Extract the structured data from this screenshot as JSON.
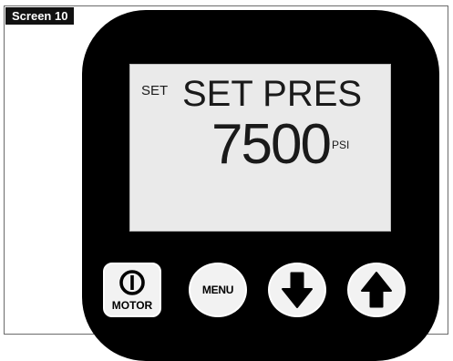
{
  "figure": {
    "label": "Screen 10"
  },
  "display": {
    "indicator": "SET",
    "mode": "SET PRES",
    "value": "7500",
    "unit": "PSI"
  },
  "buttons": {
    "motor": {
      "label": "MOTOR",
      "icon": "power-icon"
    },
    "menu": {
      "label": "MENU"
    },
    "down": {
      "icon": "arrow-down-icon"
    },
    "up": {
      "icon": "arrow-up-icon"
    }
  },
  "colors": {
    "panel": "#000000",
    "lcd_background": "#eaeaea",
    "button_face": "#f2f2f2",
    "text": "#1a1a1a"
  }
}
